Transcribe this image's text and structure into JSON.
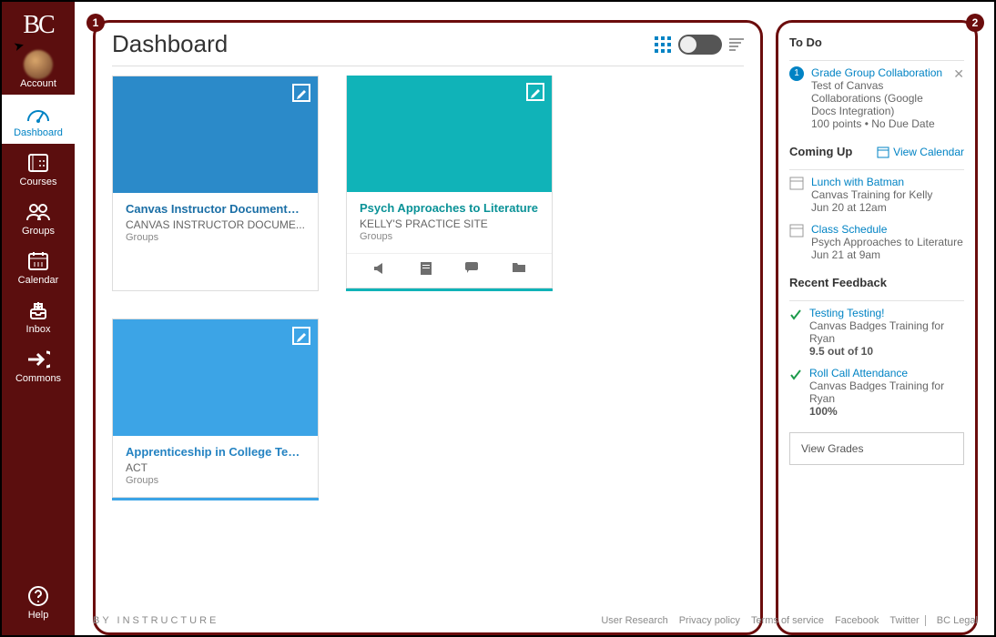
{
  "brand": "BC",
  "nav": {
    "account": "Account",
    "dashboard": "Dashboard",
    "courses": "Courses",
    "groups": "Groups",
    "calendar": "Calendar",
    "inbox": "Inbox",
    "commons": "Commons",
    "help": "Help"
  },
  "header": {
    "title": "Dashboard"
  },
  "badges": {
    "main": "1",
    "side": "2"
  },
  "courses": [
    {
      "title": "Canvas Instructor Documentatio...",
      "code": "CANVAS INSTRUCTOR DOCUME...",
      "sub": "Groups"
    },
    {
      "title": "Psych Approaches to Literature",
      "code": "KELLY'S PRACTICE SITE",
      "sub": "Groups"
    },
    {
      "title": "Apprenticeship in College Teachi...",
      "code": "ACT",
      "sub": "Groups"
    }
  ],
  "todo": {
    "heading": "To Do",
    "num": "1",
    "title": "Grade Group Collaboration",
    "line1": "Test of Canvas Collaborations (Google Docs Integration)",
    "line2": "100 points • No Due Date"
  },
  "coming": {
    "heading": "Coming Up",
    "view_cal": "View Calendar",
    "items": [
      {
        "title": "Lunch with Batman",
        "sub": "Canvas Training for Kelly",
        "when": "Jun 20 at 12am"
      },
      {
        "title": "Class Schedule",
        "sub": "Psych Approaches to Literature",
        "when": "Jun 21 at 9am"
      }
    ]
  },
  "feedback": {
    "heading": "Recent Feedback",
    "items": [
      {
        "title": "Testing Testing!",
        "sub": "Canvas Badges Training for Ryan",
        "score": "9.5 out of 10"
      },
      {
        "title": "Roll Call Attendance",
        "sub": "Canvas Badges Training for Ryan",
        "score": "100%"
      }
    ],
    "view_grades": "View Grades"
  },
  "footer": {
    "brand": "By Instructure",
    "links": [
      "User Research",
      "Privacy policy",
      "Terms of service",
      "Facebook",
      "Twitter",
      "BC Legal"
    ]
  }
}
